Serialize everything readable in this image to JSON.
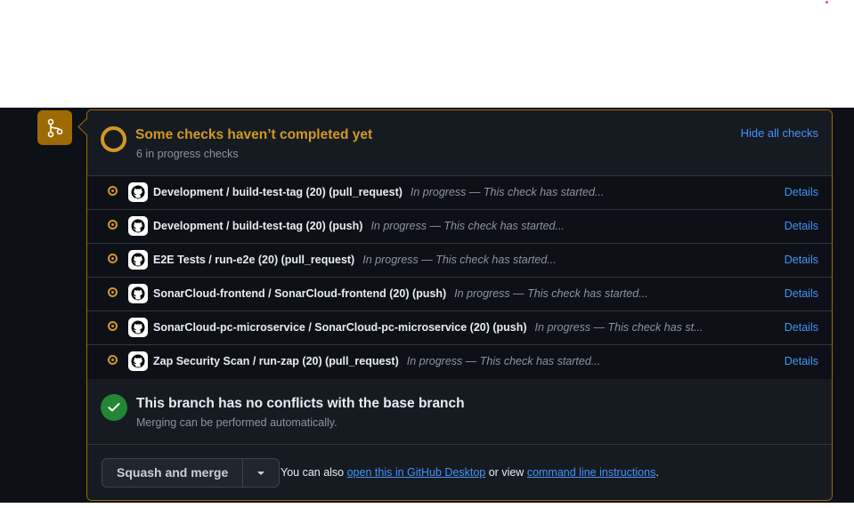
{
  "checks_header": {
    "title": "Some checks haven’t completed yet",
    "subtitle": "6 in progress checks",
    "hide_link": "Hide all checks"
  },
  "checks": [
    {
      "name": "Development / build-test-tag (20) (pull_request)",
      "status": "In progress — This check has started...",
      "details": "Details"
    },
    {
      "name": "Development / build-test-tag (20) (push)",
      "status": "In progress — This check has started...",
      "details": "Details"
    },
    {
      "name": "E2E Tests / run-e2e (20) (pull_request)",
      "status": "In progress — This check has started...",
      "details": "Details"
    },
    {
      "name": "SonarCloud-frontend / SonarCloud-frontend (20) (push)",
      "status": "In progress — This check has started...",
      "details": "Details"
    },
    {
      "name": "SonarCloud-pc-microservice / SonarCloud-pc-microservice (20) (push)",
      "status": "In progress — This check has st...",
      "details": "Details"
    },
    {
      "name": "Zap Security Scan / run-zap (20) (pull_request)",
      "status": "In progress — This check has started...",
      "details": "Details"
    }
  ],
  "conflicts": {
    "title": "This branch has no conflicts with the base branch",
    "subtitle": "Merging can be performed automatically."
  },
  "merge": {
    "button_label": "Squash and merge",
    "note_prefix": "You can also",
    "desktop_link": "open this in GitHub Desktop",
    "note_middle": "or view",
    "cli_link": "command line instructions",
    "note_suffix": "."
  },
  "colors": {
    "pending": "#d29922",
    "success": "#238636",
    "link": "#4493f8",
    "background": "#0d1117",
    "panel": "#161b22"
  }
}
